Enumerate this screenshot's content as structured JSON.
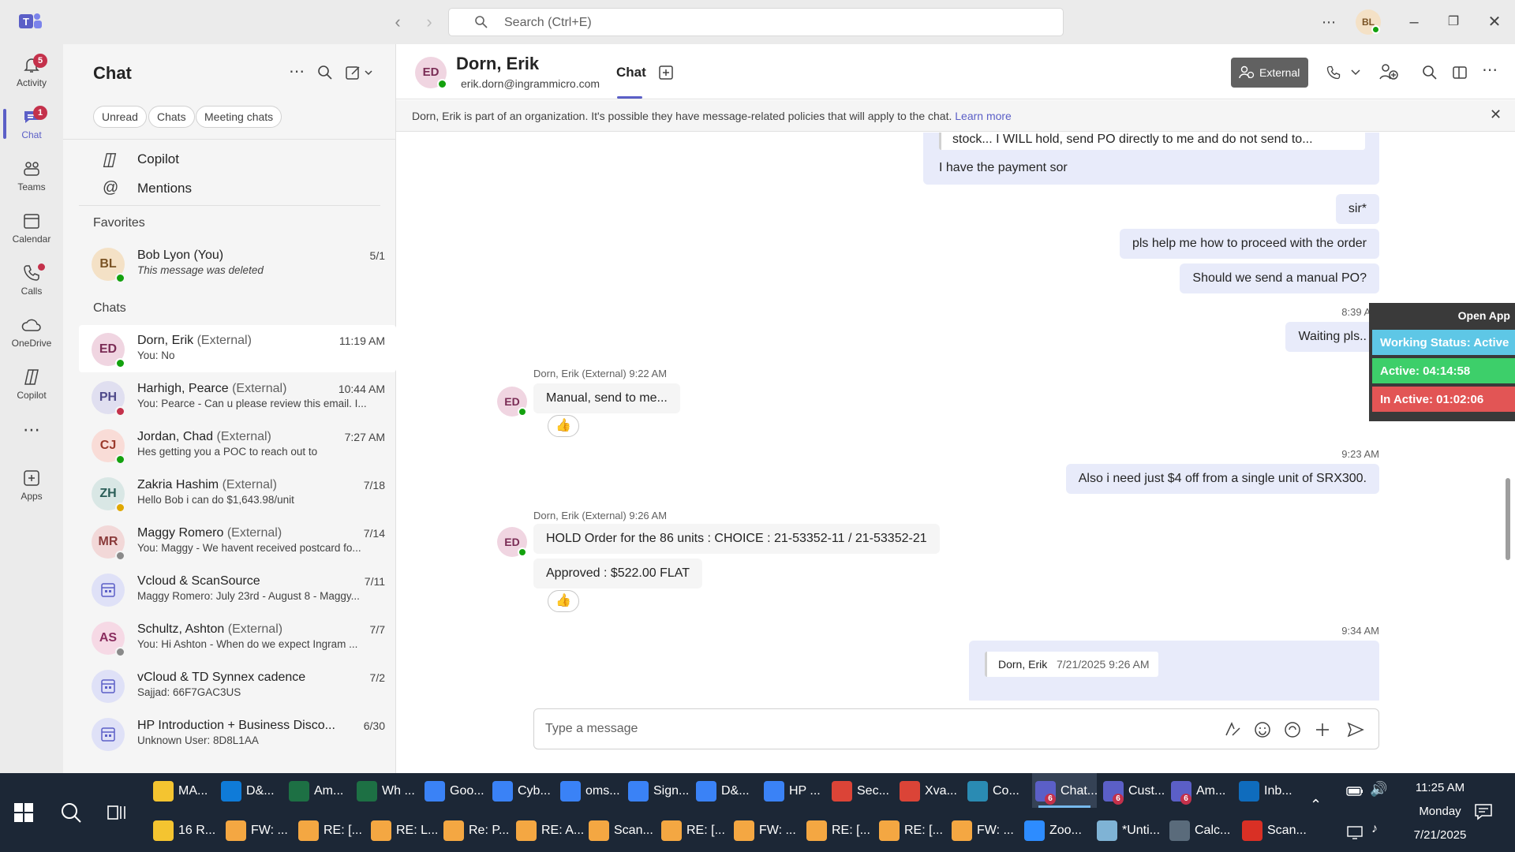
{
  "titlebar": {
    "search_placeholder": "Search (Ctrl+E)",
    "user_initials": "BL"
  },
  "rail": [
    {
      "label": "Activity",
      "badge": "5"
    },
    {
      "label": "Chat",
      "badge": "1"
    },
    {
      "label": "Teams"
    },
    {
      "label": "Calendar"
    },
    {
      "label": "Calls"
    },
    {
      "label": "OneDrive"
    },
    {
      "label": "Copilot"
    },
    {
      "label": "Apps"
    }
  ],
  "list": {
    "title": "Chat",
    "filters": [
      "Unread",
      "Chats",
      "Meeting chats"
    ],
    "copilot": "Copilot",
    "mentions": "Mentions",
    "favorites_label": "Favorites",
    "chats_label": "Chats",
    "favorites": [
      {
        "initials": "BL",
        "name": "Bob Lyon (You)",
        "ext": "",
        "preview": "This message was deleted",
        "time": "5/1"
      }
    ],
    "chats": [
      {
        "initials": "ED",
        "name": "Dorn, Erik ",
        "ext": "(External)",
        "preview": "You: No",
        "time": "11:19 AM"
      },
      {
        "initials": "PH",
        "name": "Harhigh, Pearce ",
        "ext": "(External)",
        "preview": "You: Pearce -  Can u please review this email. I...",
        "time": "10:44 AM"
      },
      {
        "initials": "CJ",
        "name": "Jordan, Chad ",
        "ext": "(External)",
        "preview": "Hes getting you a POC to reach out to",
        "time": "7:27 AM"
      },
      {
        "initials": "ZH",
        "name": "Zakria Hashim ",
        "ext": "(External)",
        "preview": "Hello Bob i can do $1,643.98/unit",
        "time": "7/18"
      },
      {
        "initials": "MR",
        "name": "Maggy Romero ",
        "ext": "(External)",
        "preview": "You: Maggy - We havent received postcard fo...",
        "time": "7/14"
      },
      {
        "initials": "",
        "name": "Vcloud & ScanSource",
        "ext": "",
        "preview": "Maggy Romero: July 23rd - August 8 - Maggy...",
        "time": "7/11"
      },
      {
        "initials": "AS",
        "name": "Schultz, Ashton ",
        "ext": "(External)",
        "preview": "You: Hi Ashton -  When do we expect Ingram ...",
        "time": "7/7"
      },
      {
        "initials": "",
        "name": "vCloud & TD Synnex cadence",
        "ext": "",
        "preview": "Sajjad: 66F7GAC3US",
        "time": "7/2"
      },
      {
        "initials": "",
        "name": "HP Introduction + Business Disco...",
        "ext": "",
        "preview": "Unknown User: 8D8L1AA",
        "time": "6/30"
      }
    ]
  },
  "header": {
    "initials": "ED",
    "name": "Dorn, Erik",
    "email": "erik.dorn@ingrammicro.com",
    "tab": "Chat",
    "external_label": "External"
  },
  "banner": {
    "text": "Dorn, Erik is part of an organization. It's possible they have message-related policies that will apply to the chat. ",
    "link": "Learn more"
  },
  "messages": {
    "quote_top": "stock... I WILL hold, send PO directly to me and do not send to...",
    "m1": "I have the payment sor",
    "m2": "sir*",
    "m3": "pls help me how to proceed with the order",
    "m4": "Should we send a manual PO?",
    "t_839": "8:39 AM",
    "m5": "Waiting pls..",
    "meta_922": "Dorn, Erik (External)   9:22 AM",
    "r1": "Manual, send to me...",
    "t_923": "9:23 AM",
    "m6": "Also i need just $4 off from a single unit of SRX300.",
    "meta_926": "Dorn, Erik (External)   9:26 AM",
    "r2": "HOLD Order for the 86 units : CHOICE : 21-53352-11 / 21-53352-21",
    "r3": "Approved : $522.00 FLAT",
    "t_934": "9:34 AM",
    "quote_bottom_name": "Dorn, Erik",
    "quote_bottom_time": "7/21/2025 9:26 AM",
    "reaction": "👍",
    "avatar": "ED"
  },
  "composer": {
    "placeholder": "Type a message"
  },
  "widget": {
    "open_app": "Open App",
    "status": "Working Status: Active",
    "active": "Active: 04:14:58",
    "inactive": "In Active: 01:02:06"
  },
  "taskbar": {
    "row1": [
      {
        "label": "MA...",
        "color": "#f4c430"
      },
      {
        "label": "D&...",
        "color": "#0f7bd8"
      },
      {
        "label": "Am...",
        "color": "#1d7044"
      },
      {
        "label": "Wh ...",
        "color": "#1d7044"
      },
      {
        "label": "Goo...",
        "color": "#3a82f6"
      },
      {
        "label": "Cyb...",
        "color": "#3a82f6"
      },
      {
        "label": "oms...",
        "color": "#3a82f6"
      },
      {
        "label": "Sign...",
        "color": "#3a82f6"
      },
      {
        "label": "D&...",
        "color": "#3a82f6"
      },
      {
        "label": "HP ...",
        "color": "#3a82f6"
      },
      {
        "label": "Sec...",
        "color": "#db4437"
      },
      {
        "label": "Xva...",
        "color": "#db4437"
      },
      {
        "label": "Co...",
        "color": "#2a8bb3"
      },
      {
        "label": "Chat...",
        "color": "#5b5fc7"
      },
      {
        "label": "Cust...",
        "color": "#5b5fc7"
      },
      {
        "label": "Am...",
        "color": "#5b5fc7"
      },
      {
        "label": "Inb...",
        "color": "#0f6cbd"
      }
    ],
    "row2": [
      {
        "label": "16 R...",
        "color": "#f4c430"
      },
      {
        "label": "FW: ...",
        "color": "#f4a742"
      },
      {
        "label": "RE: [...",
        "color": "#f4a742"
      },
      {
        "label": "RE: L...",
        "color": "#f4a742"
      },
      {
        "label": "Re: P...",
        "color": "#f4a742"
      },
      {
        "label": "RE: A...",
        "color": "#f4a742"
      },
      {
        "label": "Scan...",
        "color": "#f4a742"
      },
      {
        "label": "RE: [...",
        "color": "#f4a742"
      },
      {
        "label": "FW: ...",
        "color": "#f4a742"
      },
      {
        "label": "RE: [...",
        "color": "#f4a742"
      },
      {
        "label": "RE: [...",
        "color": "#f4a742"
      },
      {
        "label": "FW: ...",
        "color": "#f4a742"
      },
      {
        "label": "Zoo...",
        "color": "#2d8cff"
      },
      {
        "label": "*Unti...",
        "color": "#7fb3d5"
      },
      {
        "label": "Calc...",
        "color": "#5a6b7b"
      },
      {
        "label": "Scan...",
        "color": "#d93025"
      }
    ],
    "badge": "6",
    "time": "11:25 AM",
    "day": "Monday",
    "date": "7/21/2025"
  }
}
